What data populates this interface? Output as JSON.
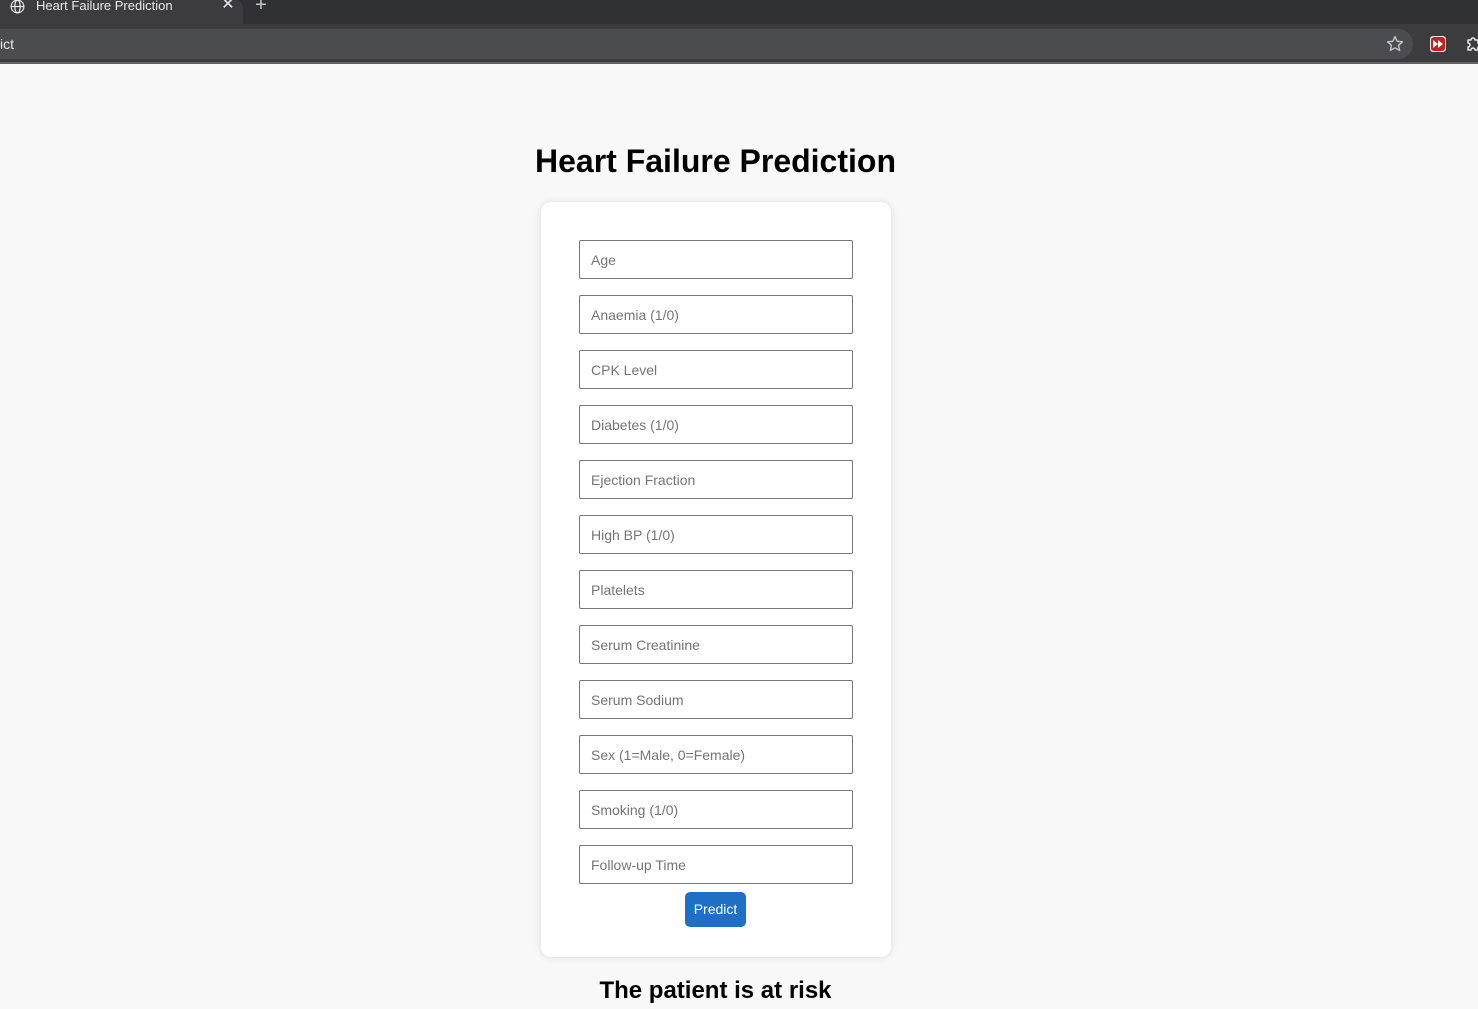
{
  "browser": {
    "tab_title": "Heart Failure Prediction",
    "tab_close": "✕",
    "new_tab": "+",
    "address_text": "ict"
  },
  "page": {
    "title": "Heart Failure Prediction",
    "fields": [
      {
        "placeholder": "Age",
        "value": ""
      },
      {
        "placeholder": "Anaemia (1/0)",
        "value": ""
      },
      {
        "placeholder": "CPK Level",
        "value": ""
      },
      {
        "placeholder": "Diabetes (1/0)",
        "value": ""
      },
      {
        "placeholder": "Ejection Fraction",
        "value": ""
      },
      {
        "placeholder": "High BP (1/0)",
        "value": ""
      },
      {
        "placeholder": "Platelets",
        "value": ""
      },
      {
        "placeholder": "Serum Creatinine",
        "value": ""
      },
      {
        "placeholder": "Serum Sodium",
        "value": ""
      },
      {
        "placeholder": "Sex (1=Male, 0=Female)",
        "value": ""
      },
      {
        "placeholder": "Smoking (1/0)",
        "value": ""
      },
      {
        "placeholder": "Follow-up Time",
        "value": ""
      }
    ],
    "predict_label": "Predict",
    "result_text": "The patient is at risk"
  },
  "colors": {
    "button": "#1f6fc5",
    "page_background": "#f8f8f8",
    "card_background": "#ffffff"
  },
  "icons": [
    "globe-icon",
    "close-icon",
    "plus-icon",
    "star-icon",
    "extension-icon",
    "puzzle-icon"
  ]
}
